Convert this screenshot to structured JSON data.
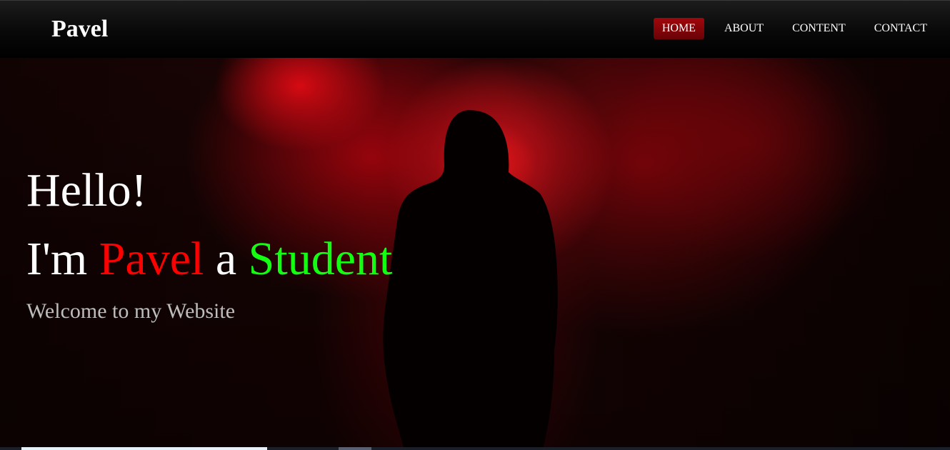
{
  "navbar": {
    "brand": "Pavel",
    "links": [
      {
        "label": "HOME",
        "active": true
      },
      {
        "label": "ABOUT",
        "active": false
      },
      {
        "label": "CONTENT",
        "active": false
      },
      {
        "label": "CONTACT",
        "active": false
      }
    ]
  },
  "hero": {
    "greeting": "Hello!",
    "intro_prefix": "I'm",
    "name": "Pavel",
    "intro_middle": "a",
    "role": "Student",
    "tagline": "Welcome to my Website"
  },
  "colors": {
    "accent_active_nav": "#8c0409",
    "name_color": "#ff0000",
    "role_color": "#12ff12",
    "tagline_color": "#bdbdbd"
  },
  "icons": {
    "hero_image": "hooded-figure-in-red-smoke"
  }
}
